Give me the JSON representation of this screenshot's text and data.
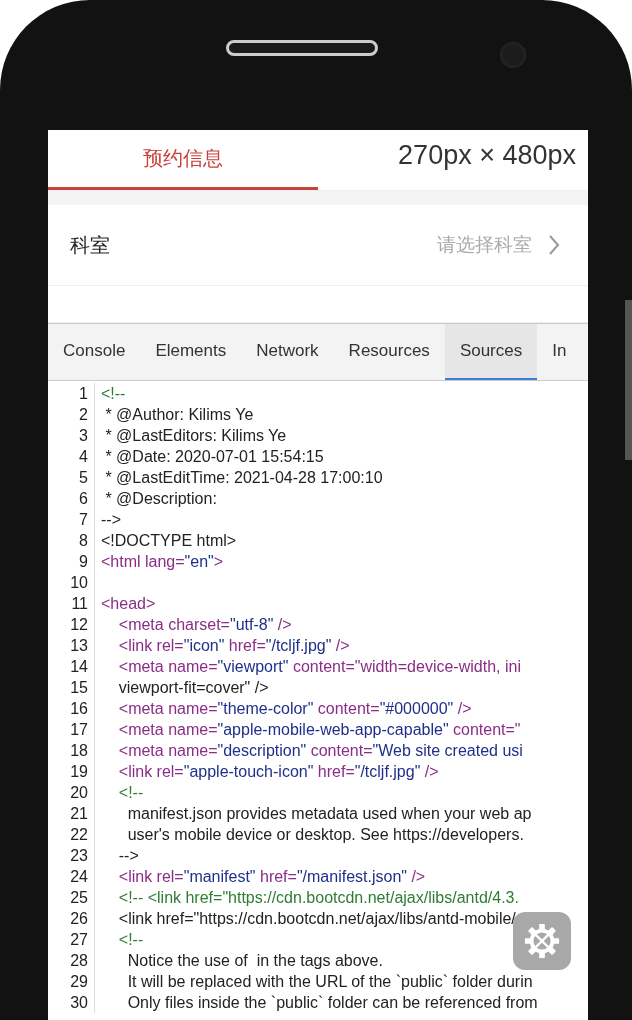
{
  "app": {
    "tabs": [
      {
        "label": "预约信息",
        "selected": true
      }
    ],
    "size_overlay": "270px × 480px",
    "rows": [
      {
        "label": "科室",
        "placeholder": "请选择科室"
      }
    ]
  },
  "devtools": {
    "tabs": [
      {
        "label": "Console",
        "selected": false
      },
      {
        "label": "Elements",
        "selected": false
      },
      {
        "label": "Network",
        "selected": false
      },
      {
        "label": "Resources",
        "selected": false
      },
      {
        "label": "Sources",
        "selected": true
      },
      {
        "label": "In",
        "selected": false
      }
    ],
    "lines": [
      {
        "number": "1",
        "segments": [
          {
            "kind": "comment",
            "text": "<!--"
          }
        ]
      },
      {
        "number": "2",
        "segments": [
          {
            "kind": "text",
            "text": " * @Author: Kilims Ye"
          }
        ]
      },
      {
        "number": "3",
        "segments": [
          {
            "kind": "text",
            "text": " * @LastEditors: Kilims Ye"
          }
        ]
      },
      {
        "number": "4",
        "segments": [
          {
            "kind": "text",
            "text": " * @Date: 2020-07-01 15:54:15"
          }
        ]
      },
      {
        "number": "5",
        "segments": [
          {
            "kind": "text",
            "text": " * @LastEditTime: 2021-04-28 17:00:10"
          }
        ]
      },
      {
        "number": "6",
        "segments": [
          {
            "kind": "text",
            "text": " * @Description:"
          }
        ]
      },
      {
        "number": "7",
        "segments": [
          {
            "kind": "text",
            "text": "-->"
          }
        ]
      },
      {
        "number": "8",
        "segments": [
          {
            "kind": "text",
            "text": "<!DOCTYPE html>"
          }
        ]
      },
      {
        "number": "9",
        "segments": [
          {
            "kind": "tag",
            "text": "<html lang="
          },
          {
            "kind": "value",
            "text": "\"en\""
          },
          {
            "kind": "tag",
            "text": ">"
          }
        ]
      },
      {
        "number": "10"
      },
      {
        "number": "11",
        "segments": [
          {
            "kind": "tag",
            "text": "<head>"
          }
        ]
      },
      {
        "number": "12",
        "segments": [
          {
            "kind": "tag",
            "text": "    <meta charset="
          },
          {
            "kind": "value",
            "text": "\"utf-8\""
          },
          {
            "kind": "tag",
            "text": " />"
          }
        ]
      },
      {
        "number": "13",
        "segments": [
          {
            "kind": "tag",
            "text": "    <link rel="
          },
          {
            "kind": "value",
            "text": "\"icon\""
          },
          {
            "kind": "tag",
            "text": " href="
          },
          {
            "kind": "value",
            "text": "\"/tcljf.jpg\""
          },
          {
            "kind": "tag",
            "text": " />"
          }
        ]
      },
      {
        "number": "14",
        "segments": [
          {
            "kind": "tag",
            "text": "    <meta name="
          },
          {
            "kind": "value",
            "text": "\"viewport\""
          },
          {
            "kind": "tag",
            "text": " content=\"width=device-width, ini"
          }
        ]
      },
      {
        "number": "15",
        "segments": [
          {
            "kind": "text",
            "text": "    viewport-fit=cover\" />"
          }
        ]
      },
      {
        "number": "16",
        "segments": [
          {
            "kind": "tag",
            "text": "    <meta name="
          },
          {
            "kind": "value",
            "text": "\"theme-color\""
          },
          {
            "kind": "tag",
            "text": " content="
          },
          {
            "kind": "value",
            "text": "\"#000000\""
          },
          {
            "kind": "tag",
            "text": " />"
          }
        ]
      },
      {
        "number": "17",
        "segments": [
          {
            "kind": "tag",
            "text": "    <meta name="
          },
          {
            "kind": "value",
            "text": "\"apple-mobile-web-app-capable\""
          },
          {
            "kind": "tag",
            "text": " content=\""
          }
        ]
      },
      {
        "number": "18",
        "segments": [
          {
            "kind": "tag",
            "text": "    <meta name="
          },
          {
            "kind": "value",
            "text": "\"description\""
          },
          {
            "kind": "tag",
            "text": " content="
          },
          {
            "kind": "value",
            "text": "\"Web site created usi"
          }
        ]
      },
      {
        "number": "19",
        "segments": [
          {
            "kind": "tag",
            "text": "    <link rel="
          },
          {
            "kind": "value",
            "text": "\"apple-touch-icon\""
          },
          {
            "kind": "tag",
            "text": " href="
          },
          {
            "kind": "value",
            "text": "\"/tcljf.jpg\""
          },
          {
            "kind": "tag",
            "text": " />"
          }
        ]
      },
      {
        "number": "20",
        "segments": [
          {
            "kind": "comment",
            "text": "    <!--"
          }
        ]
      },
      {
        "number": "21",
        "segments": [
          {
            "kind": "text",
            "text": "      manifest.json provides metadata used when your web ap"
          }
        ]
      },
      {
        "number": "22",
        "segments": [
          {
            "kind": "text",
            "text": "      user's mobile device or desktop. See https://developers."
          }
        ]
      },
      {
        "number": "23",
        "segments": [
          {
            "kind": "text",
            "text": "    -->"
          }
        ]
      },
      {
        "number": "24",
        "segments": [
          {
            "kind": "tag",
            "text": "    <link rel="
          },
          {
            "kind": "value",
            "text": "\"manifest\""
          },
          {
            "kind": "tag",
            "text": " href="
          },
          {
            "kind": "value",
            "text": "\"/manifest.json\""
          },
          {
            "kind": "tag",
            "text": " />"
          }
        ]
      },
      {
        "number": "25",
        "segments": [
          {
            "kind": "comment",
            "text": "    <!-- <link href=\"https://cdn.bootcdn.net/ajax/libs/antd/4.3."
          }
        ]
      },
      {
        "number": "26",
        "segments": [
          {
            "kind": "text",
            "text": "    <link href=\"https://cdn.bootcdn.net/ajax/libs/antd-mobile/"
          }
        ]
      },
      {
        "number": "27",
        "segments": [
          {
            "kind": "comment",
            "text": "    <!--"
          }
        ]
      },
      {
        "number": "28",
        "segments": [
          {
            "kind": "text",
            "text": "      Notice the use of  in the tags above."
          }
        ]
      },
      {
        "number": "29",
        "segments": [
          {
            "kind": "text",
            "text": "      It will be replaced with the URL of the `public` folder durin"
          }
        ]
      },
      {
        "number": "30",
        "segments": [
          {
            "kind": "text",
            "text": "      Only files inside the `public` folder can be referenced from"
          }
        ]
      }
    ]
  }
}
